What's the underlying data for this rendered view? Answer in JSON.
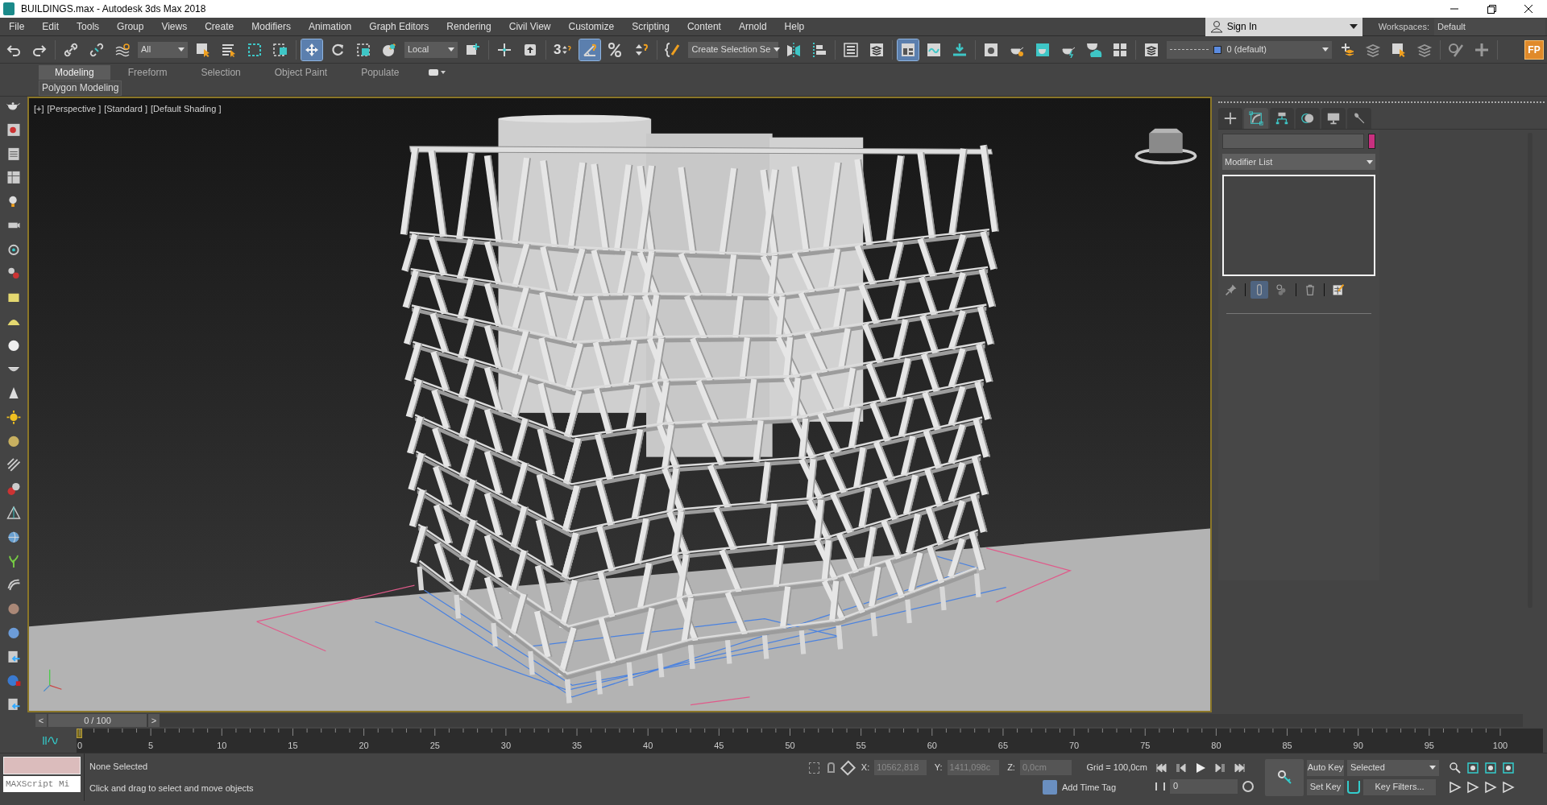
{
  "window": {
    "title": "BUILDINGS.max - Autodesk 3ds Max 2018"
  },
  "menu": [
    "File",
    "Edit",
    "Tools",
    "Group",
    "Views",
    "Create",
    "Modifiers",
    "Animation",
    "Graph Editors",
    "Rendering",
    "Civil View",
    "Customize",
    "Scripting",
    "Content",
    "Arnold",
    "Help"
  ],
  "account": {
    "label": "Sign In"
  },
  "workspaces": {
    "label": "Workspaces:",
    "value": "Default"
  },
  "toolbar": [
    {
      "kind": "undo",
      "active": false
    },
    {
      "kind": "redo",
      "active": false
    },
    {
      "kind": "sep"
    },
    {
      "kind": "link",
      "active": false
    },
    {
      "kind": "unlink",
      "active": false
    },
    {
      "kind": "bind",
      "active": false
    },
    {
      "kind": "dropdown",
      "value": "All"
    },
    {
      "kind": "select",
      "active": false
    },
    {
      "kind": "byname",
      "active": false
    },
    {
      "kind": "region",
      "active": false
    },
    {
      "kind": "crossing",
      "active": false
    },
    {
      "kind": "sep"
    },
    {
      "kind": "move",
      "active": true
    },
    {
      "kind": "rotate",
      "active": false
    },
    {
      "kind": "scale",
      "active": false
    },
    {
      "kind": "place",
      "active": false
    },
    {
      "kind": "dropdown",
      "value": "Local"
    },
    {
      "kind": "pivot",
      "active": false
    },
    {
      "kind": "sep"
    },
    {
      "kind": "manipulate",
      "active": false
    },
    {
      "kind": "keyboard",
      "active": false
    },
    {
      "kind": "sep"
    },
    {
      "kind": "snap",
      "label": "3",
      "active": false
    },
    {
      "kind": "angle",
      "active": true
    },
    {
      "kind": "percent",
      "active": false
    },
    {
      "kind": "spinner",
      "active": false
    },
    {
      "kind": "sep"
    },
    {
      "kind": "namedsets",
      "active": false
    },
    {
      "kind": "dropdown",
      "value": "Create Selection Se"
    },
    {
      "kind": "mirror",
      "active": false
    },
    {
      "kind": "align",
      "active": false
    },
    {
      "kind": "sep"
    },
    {
      "kind": "explorer",
      "active": false
    },
    {
      "kind": "layers",
      "active": false
    },
    {
      "kind": "sep"
    },
    {
      "kind": "ribbon",
      "active": true
    },
    {
      "kind": "curve",
      "active": false
    },
    {
      "kind": "schematic",
      "active": false
    },
    {
      "kind": "sep"
    },
    {
      "kind": "material",
      "active": false
    },
    {
      "kind": "rendersetup",
      "active": false
    },
    {
      "kind": "frame",
      "active": false
    },
    {
      "kind": "render",
      "active": false
    },
    {
      "kind": "cloud",
      "active": false
    },
    {
      "kind": "gallery",
      "active": false
    },
    {
      "kind": "sep"
    },
    {
      "kind": "layers",
      "active": false
    },
    {
      "kind": "layerdropdown",
      "value": "0 (default)"
    },
    {
      "kind": "addlayer",
      "active": false
    },
    {
      "kind": "stack",
      "active": false
    },
    {
      "kind": "selectlayer",
      "active": false
    },
    {
      "kind": "stack",
      "active": false
    },
    {
      "kind": "sep"
    },
    {
      "kind": "brush",
      "active": false
    },
    {
      "kind": "addtool",
      "active": false
    },
    {
      "kind": "sep"
    },
    {
      "kind": "badge",
      "label": "FP"
    }
  ],
  "ribbon": {
    "tabs": [
      {
        "label": "Modeling",
        "selected": true
      },
      {
        "label": "Freeform",
        "selected": false
      },
      {
        "label": "Selection",
        "selected": false
      },
      {
        "label": "Object Paint",
        "selected": false
      },
      {
        "label": "Populate",
        "selected": false
      }
    ],
    "panel": "Polygon Modeling"
  },
  "viewport": {
    "labels": [
      "[+]",
      "[Perspective ]",
      "[Standard ]",
      "[Default Shading ]"
    ]
  },
  "command_panel": {
    "tabs": [
      {
        "kind": "create",
        "selected": false
      },
      {
        "kind": "modify",
        "selected": true
      },
      {
        "kind": "hierarchy",
        "selected": false
      },
      {
        "kind": "motion",
        "selected": false
      },
      {
        "kind": "display",
        "selected": false
      },
      {
        "kind": "utilities",
        "selected": false
      }
    ],
    "modifier_list": "Modifier List",
    "stack_buttons": [
      {
        "kind": "pin",
        "active": false
      },
      {
        "kind": "endresult",
        "active": true
      },
      {
        "kind": "unique",
        "active": false
      },
      {
        "kind": "remove",
        "active": false
      },
      {
        "kind": "configure",
        "active": false
      }
    ]
  },
  "timeline": {
    "prev": "<",
    "frame": "0 / 100",
    "next": ">",
    "ruler_labels": [
      "0",
      "5",
      "10",
      "15",
      "20",
      "25",
      "30",
      "35",
      "40",
      "45",
      "50",
      "55",
      "60",
      "65",
      "70",
      "75",
      "80",
      "85",
      "90",
      "95",
      "100"
    ]
  },
  "status": {
    "maxscript": "MAXScript Mi",
    "selection": "None Selected",
    "prompt": "Click and drag to select and move objects",
    "coords": [
      {
        "label": "X:",
        "value": "10562,818",
        "disabled": true
      },
      {
        "label": "Y:",
        "value": "1411,098c",
        "disabled": true
      },
      {
        "label": "Z:",
        "value": "0,0cm",
        "disabled": true
      }
    ],
    "grid": "Grid = 100,0cm",
    "time_tag": "Add Time Tag",
    "current_frame": "0",
    "auto_key": "Auto Key",
    "set_key": "Set Key",
    "key_mode": "Selected",
    "key_filters": "Key Filters..."
  }
}
